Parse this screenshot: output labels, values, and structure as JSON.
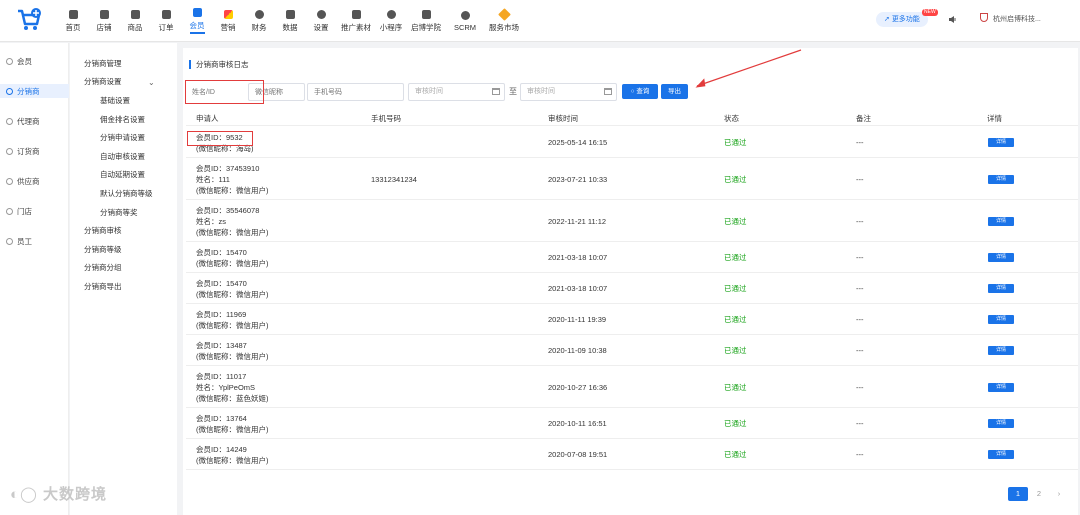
{
  "nav": [
    {
      "label": "首页",
      "icon": "home-icon"
    },
    {
      "label": "店铺",
      "icon": "store-icon"
    },
    {
      "label": "商品",
      "icon": "goods-icon"
    },
    {
      "label": "订单",
      "icon": "order-icon"
    },
    {
      "label": "会员",
      "icon": "member-icon",
      "active": true
    },
    {
      "label": "营销",
      "icon": "marketing-icon"
    },
    {
      "label": "财务",
      "icon": "finance-icon"
    },
    {
      "label": "数据",
      "icon": "data-icon"
    },
    {
      "label": "设置",
      "icon": "settings-icon"
    },
    {
      "label": "推广素材",
      "icon": "promo-icon"
    },
    {
      "label": "小程序",
      "icon": "miniapp-icon"
    },
    {
      "label": "启博学院",
      "icon": "academy-icon"
    },
    {
      "label": "SCRM",
      "icon": "scrm-icon"
    },
    {
      "label": "服务市场",
      "icon": "market-icon"
    }
  ],
  "header": {
    "feature_btn": "更多功能",
    "new_badge": "NEW",
    "company": "杭州启博科技..."
  },
  "sidebar1": [
    {
      "label": "会员"
    },
    {
      "label": "分销商",
      "active": true
    },
    {
      "label": "代理商"
    },
    {
      "label": "订货商"
    },
    {
      "label": "供应商"
    },
    {
      "label": "门店"
    },
    {
      "label": "员工"
    }
  ],
  "sidebar2": [
    {
      "label": "分销商管理",
      "sub": false
    },
    {
      "label": "分销商设置",
      "sub": false
    },
    {
      "label": "基础设置",
      "sub": true
    },
    {
      "label": "佣金排名设置",
      "sub": true
    },
    {
      "label": "分销申请设置",
      "sub": true
    },
    {
      "label": "自动审核设置",
      "sub": true
    },
    {
      "label": "自动延期设置",
      "sub": true
    },
    {
      "label": "默认分销商等级",
      "sub": true
    },
    {
      "label": "分销商等奖",
      "sub": true
    },
    {
      "label": "分销商审核",
      "sub": false
    },
    {
      "label": "分销商等级",
      "sub": false
    },
    {
      "label": "分销商分组",
      "sub": false
    },
    {
      "label": "分销商导出",
      "sub": false
    }
  ],
  "panel": {
    "title": "分销商审核日志",
    "search": {
      "name_placeholder": "姓名/ID",
      "nick_placeholder": "微信昵称",
      "phone_placeholder": "手机号码",
      "start_placeholder": "审核时间",
      "end_placeholder": "审核时间",
      "tilde": "至",
      "query_label": "查询",
      "export_label": "导出"
    },
    "columns": [
      "申请人",
      "手机号码",
      "审核时间",
      "状态",
      "备注",
      "详情"
    ],
    "rows": [
      {
        "lines": [
          "会员ID：9532",
          "(微信昵称：海岛)"
        ],
        "phone": "",
        "time": "2025-05-14 16:15",
        "status": "已通过",
        "note": "---",
        "detail": "详情"
      },
      {
        "lines": [
          "会员ID：37453910",
          "姓名：111",
          "(微信昵称：微信用户)"
        ],
        "phone": "13312341234",
        "time": "2023-07-21 10:33",
        "status": "已通过",
        "note": "---",
        "detail": "详情"
      },
      {
        "lines": [
          "会员ID：35546078",
          "姓名：zs",
          "(微信昵称：微信用户)"
        ],
        "phone": "",
        "time": "2022-11-21 11:12",
        "status": "已通过",
        "note": "---",
        "detail": "详情"
      },
      {
        "lines": [
          "会员ID：15470",
          "(微信昵称：微信用户)"
        ],
        "phone": "",
        "time": "2021-03-18 10:07",
        "status": "已通过",
        "note": "---",
        "detail": "详情"
      },
      {
        "lines": [
          "会员ID：15470",
          "(微信昵称：微信用户)"
        ],
        "phone": "",
        "time": "2021-03-18 10:07",
        "status": "已通过",
        "note": "---",
        "detail": "详情"
      },
      {
        "lines": [
          "会员ID：11969",
          "(微信昵称：微信用户)"
        ],
        "phone": "",
        "time": "2020-11-11 19:39",
        "status": "已通过",
        "note": "---",
        "detail": "详情"
      },
      {
        "lines": [
          "会员ID：13487",
          "(微信昵称：微信用户)"
        ],
        "phone": "",
        "time": "2020-11-09 10:38",
        "status": "已通过",
        "note": "---",
        "detail": "详情"
      },
      {
        "lines": [
          "会员ID：11017",
          "姓名：YplPeOmS",
          "(微信昵称：蓝色妖姬)"
        ],
        "phone": "",
        "time": "2020-10-27 16:36",
        "status": "已通过",
        "note": "---",
        "detail": "详情"
      },
      {
        "lines": [
          "会员ID：13764",
          "(微信昵称：微信用户)"
        ],
        "phone": "",
        "time": "2020-10-11 16:51",
        "status": "已通过",
        "note": "---",
        "detail": "详情"
      },
      {
        "lines": [
          "会员ID：14249",
          "(微信昵称：微信用户)"
        ],
        "phone": "",
        "time": "2020-07-08 19:51",
        "status": "已通过",
        "note": "---",
        "detail": "详情"
      }
    ]
  },
  "pagination": {
    "current": "1",
    "next_page": "2",
    "next_arrow": "›"
  },
  "watermark": "大数跨境"
}
